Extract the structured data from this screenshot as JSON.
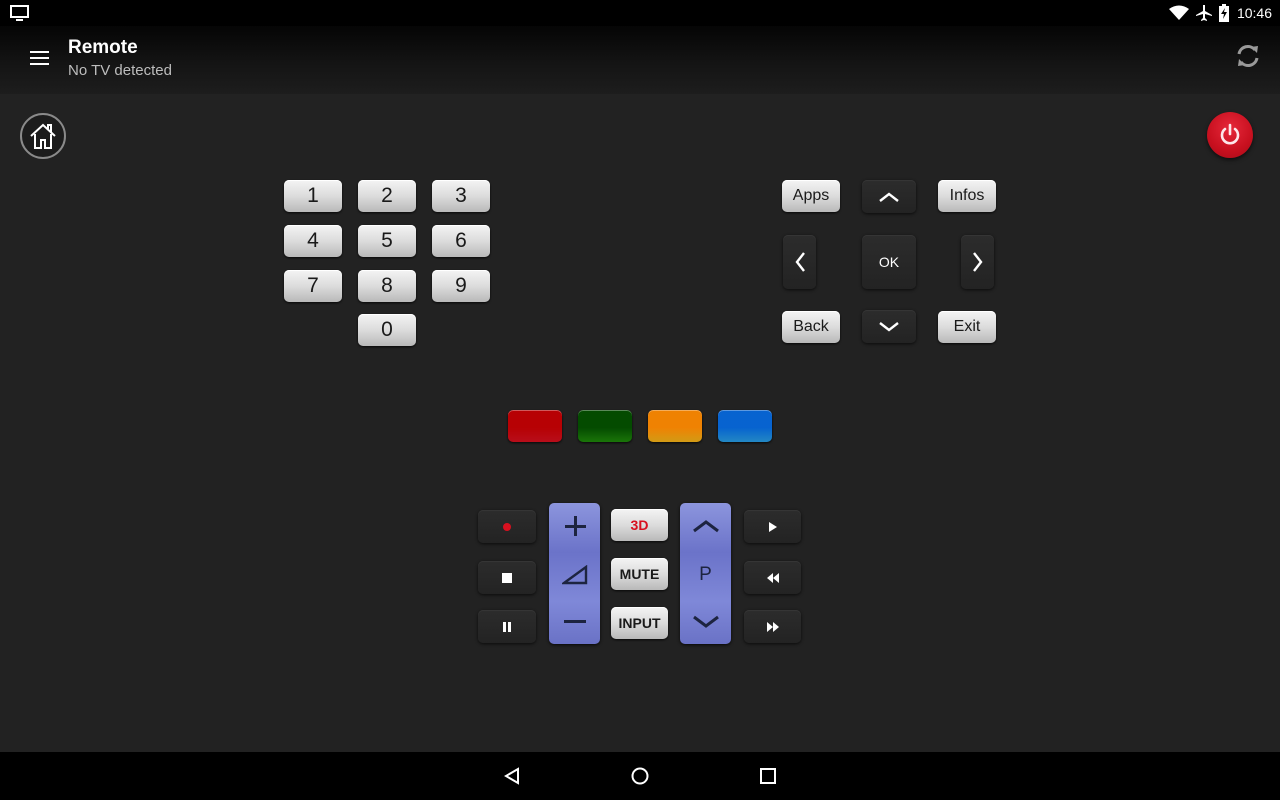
{
  "status_bar": {
    "left_icon": "tv-monitor-icon",
    "icons": [
      "wifi-icon",
      "airplane-icon",
      "battery-charging-icon"
    ],
    "time": "10:46"
  },
  "app_bar": {
    "title": "Remote",
    "subtitle": "No TV detected",
    "menu_icon": "hamburger-menu-icon",
    "refresh_icon": "refresh-icon"
  },
  "home_button": {
    "icon": "home-icon"
  },
  "power_button": {
    "icon": "power-icon",
    "color": "#c8101f"
  },
  "numpad": {
    "keys": [
      "1",
      "2",
      "3",
      "4",
      "5",
      "6",
      "7",
      "8",
      "9",
      "0"
    ]
  },
  "navigation": {
    "apps": "Apps",
    "infos": "Infos",
    "ok": "OK",
    "back": "Back",
    "exit": "Exit",
    "up_icon": "chevron-up-icon",
    "down_icon": "chevron-down-icon",
    "left_icon": "chevron-left-icon",
    "right_icon": "chevron-right-icon"
  },
  "color_keys": [
    {
      "name": "red",
      "color": "#d8101f"
    },
    {
      "name": "green",
      "color": "#1f8a0a"
    },
    {
      "name": "yellow",
      "color": "#f7b619"
    },
    {
      "name": "blue",
      "color": "#2a9fe6"
    }
  ],
  "media": {
    "record_icon": "record-icon",
    "stop_icon": "stop-icon",
    "pause_icon": "pause-icon",
    "play_icon": "play-icon",
    "rewind_icon": "rewind-icon",
    "fast_forward_icon": "fast-forward-icon"
  },
  "volume": {
    "plus_icon": "plus-icon",
    "volume_icon": "volume-triangle-icon",
    "minus_icon": "minus-icon"
  },
  "center_keys": {
    "three_d": "3D",
    "three_d_color": "#d8101f",
    "mute": "MUTE",
    "input": "INPUT"
  },
  "channel": {
    "label": "P",
    "up_icon": "chevron-up-icon",
    "down_icon": "chevron-down-icon"
  },
  "nav_bar": {
    "back_icon": "back-triangle-icon",
    "home_icon": "home-circle-icon",
    "recents_icon": "recents-square-icon"
  }
}
